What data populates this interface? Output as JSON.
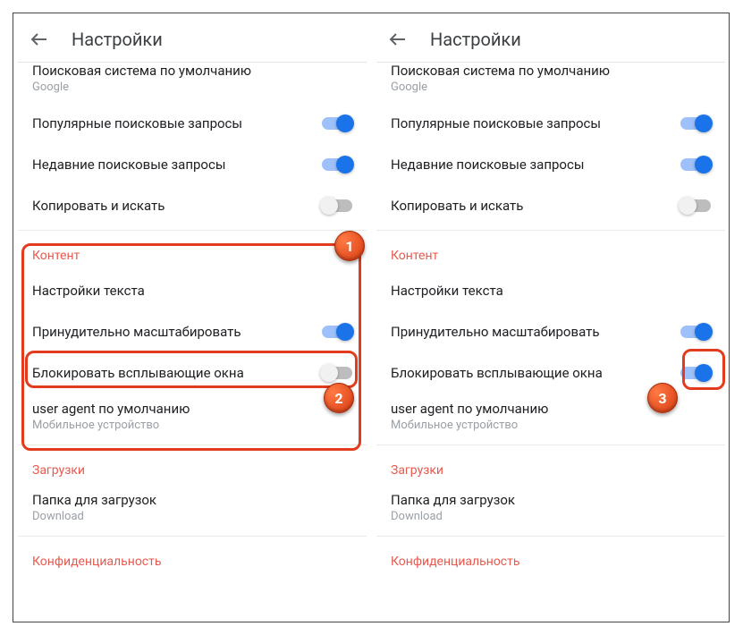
{
  "header": {
    "title": "Настройки"
  },
  "search_engine": {
    "label": "Поисковая система по умолчанию",
    "value": "Google"
  },
  "top_toggles": {
    "popular": {
      "label": "Популярные поисковые запросы",
      "on": true
    },
    "recent": {
      "label": "Недавние поисковые запросы",
      "on": true
    },
    "copy": {
      "label": "Копировать и искать",
      "on": false
    }
  },
  "sections": {
    "content": "Контент",
    "downloads": "Загрузки",
    "privacy": "Конфиденциальность"
  },
  "content_rows": {
    "text_settings": {
      "label": "Настройки текста"
    },
    "force_zoom": {
      "label": "Принудительно масштабировать",
      "on": true
    },
    "block_popups": {
      "label": "Блокировать всплывающие окна",
      "on_left": false,
      "on_right": true
    },
    "user_agent": {
      "label": "user agent по умолчанию",
      "sub": "Мобильное устройство"
    }
  },
  "downloads_row": {
    "label": "Папка для загрузок",
    "sub": "Download"
  },
  "badges": {
    "b1": "1",
    "b2": "2",
    "b3": "3"
  }
}
